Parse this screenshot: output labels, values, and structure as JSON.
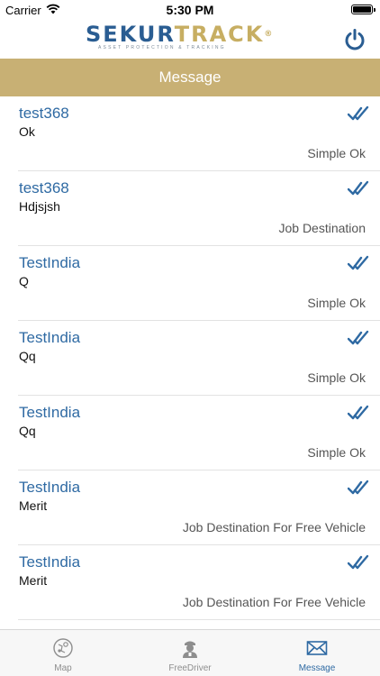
{
  "status_bar": {
    "carrier": "Carrier",
    "time": "5:30 PM"
  },
  "brand": {
    "logo_part1": "SEKUR",
    "logo_part2": "TRACK",
    "logo_registered": "®",
    "tagline": "ASSET PROTECTION & TRACKING",
    "primary_color": "#2a5d92",
    "accent_color": "#c7ae62",
    "logout_icon": "power-icon"
  },
  "title_bar": {
    "title": "Message",
    "color": "#c8b074"
  },
  "messages": [
    {
      "sender": "test368",
      "body": "Ok",
      "type": "Simple Ok",
      "status_icon": "double-check-icon"
    },
    {
      "sender": "test368",
      "body": "Hdjsjsh",
      "type": "Job Destination",
      "status_icon": "double-check-icon"
    },
    {
      "sender": "TestIndia",
      "body": "Q",
      "type": "Simple Ok",
      "status_icon": "double-check-icon"
    },
    {
      "sender": "TestIndia",
      "body": "Qq",
      "type": "Simple Ok",
      "status_icon": "double-check-icon"
    },
    {
      "sender": "TestIndia",
      "body": "Qq",
      "type": "Simple Ok",
      "status_icon": "double-check-icon"
    },
    {
      "sender": "TestIndia",
      "body": "Merit",
      "type": "Job Destination For Free Vehicle",
      "status_icon": "double-check-icon"
    },
    {
      "sender": "TestIndia",
      "body": "Merit",
      "type": "Job Destination For Free Vehicle",
      "status_icon": "double-check-icon"
    }
  ],
  "tabs": [
    {
      "label": "Map",
      "icon": "map-icon",
      "active": false
    },
    {
      "label": "FreeDriver",
      "icon": "driver-icon",
      "active": false
    },
    {
      "label": "Message",
      "icon": "envelope-icon",
      "active": true
    }
  ]
}
